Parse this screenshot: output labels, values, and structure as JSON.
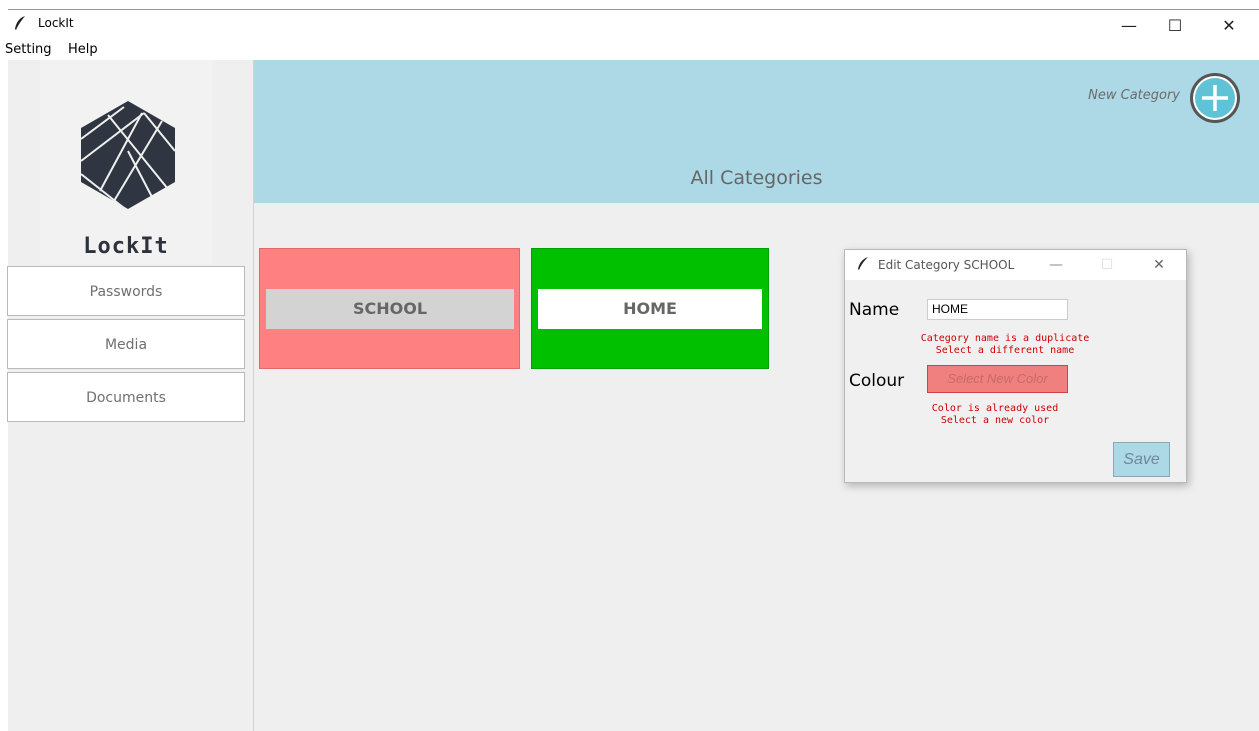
{
  "window": {
    "title": "LockIt",
    "controls": {
      "minimize": "—",
      "maximize": "☐",
      "close": "✕"
    }
  },
  "menu": {
    "items": [
      "Setting",
      "Help"
    ]
  },
  "sidebar": {
    "app_name": "LockIt",
    "nav": [
      "Passwords",
      "Media",
      "Documents"
    ]
  },
  "header": {
    "title": "All Categories",
    "new_category_label": "New Category"
  },
  "categories": [
    {
      "name": "SCHOOL",
      "card_color": "#ff8080",
      "label_bg": "#d3d3d3"
    },
    {
      "name": "HOME",
      "card_color": "#00c000",
      "label_bg": "#ffffff"
    }
  ],
  "dialog": {
    "title": "Edit Category SCHOOL",
    "name_label": "Name",
    "name_value": "HOME",
    "name_error_line1": "Category name is a duplicate",
    "name_error_line2": "Select a different name",
    "colour_label": "Colour",
    "color_button": "Select New Color",
    "color_error_line1": "Color is already used",
    "color_error_line2": "Select a new color",
    "save_button": "Save"
  },
  "colors": {
    "header_bg": "#add8e6",
    "body_bg": "#efefef",
    "error": "#d10000"
  }
}
